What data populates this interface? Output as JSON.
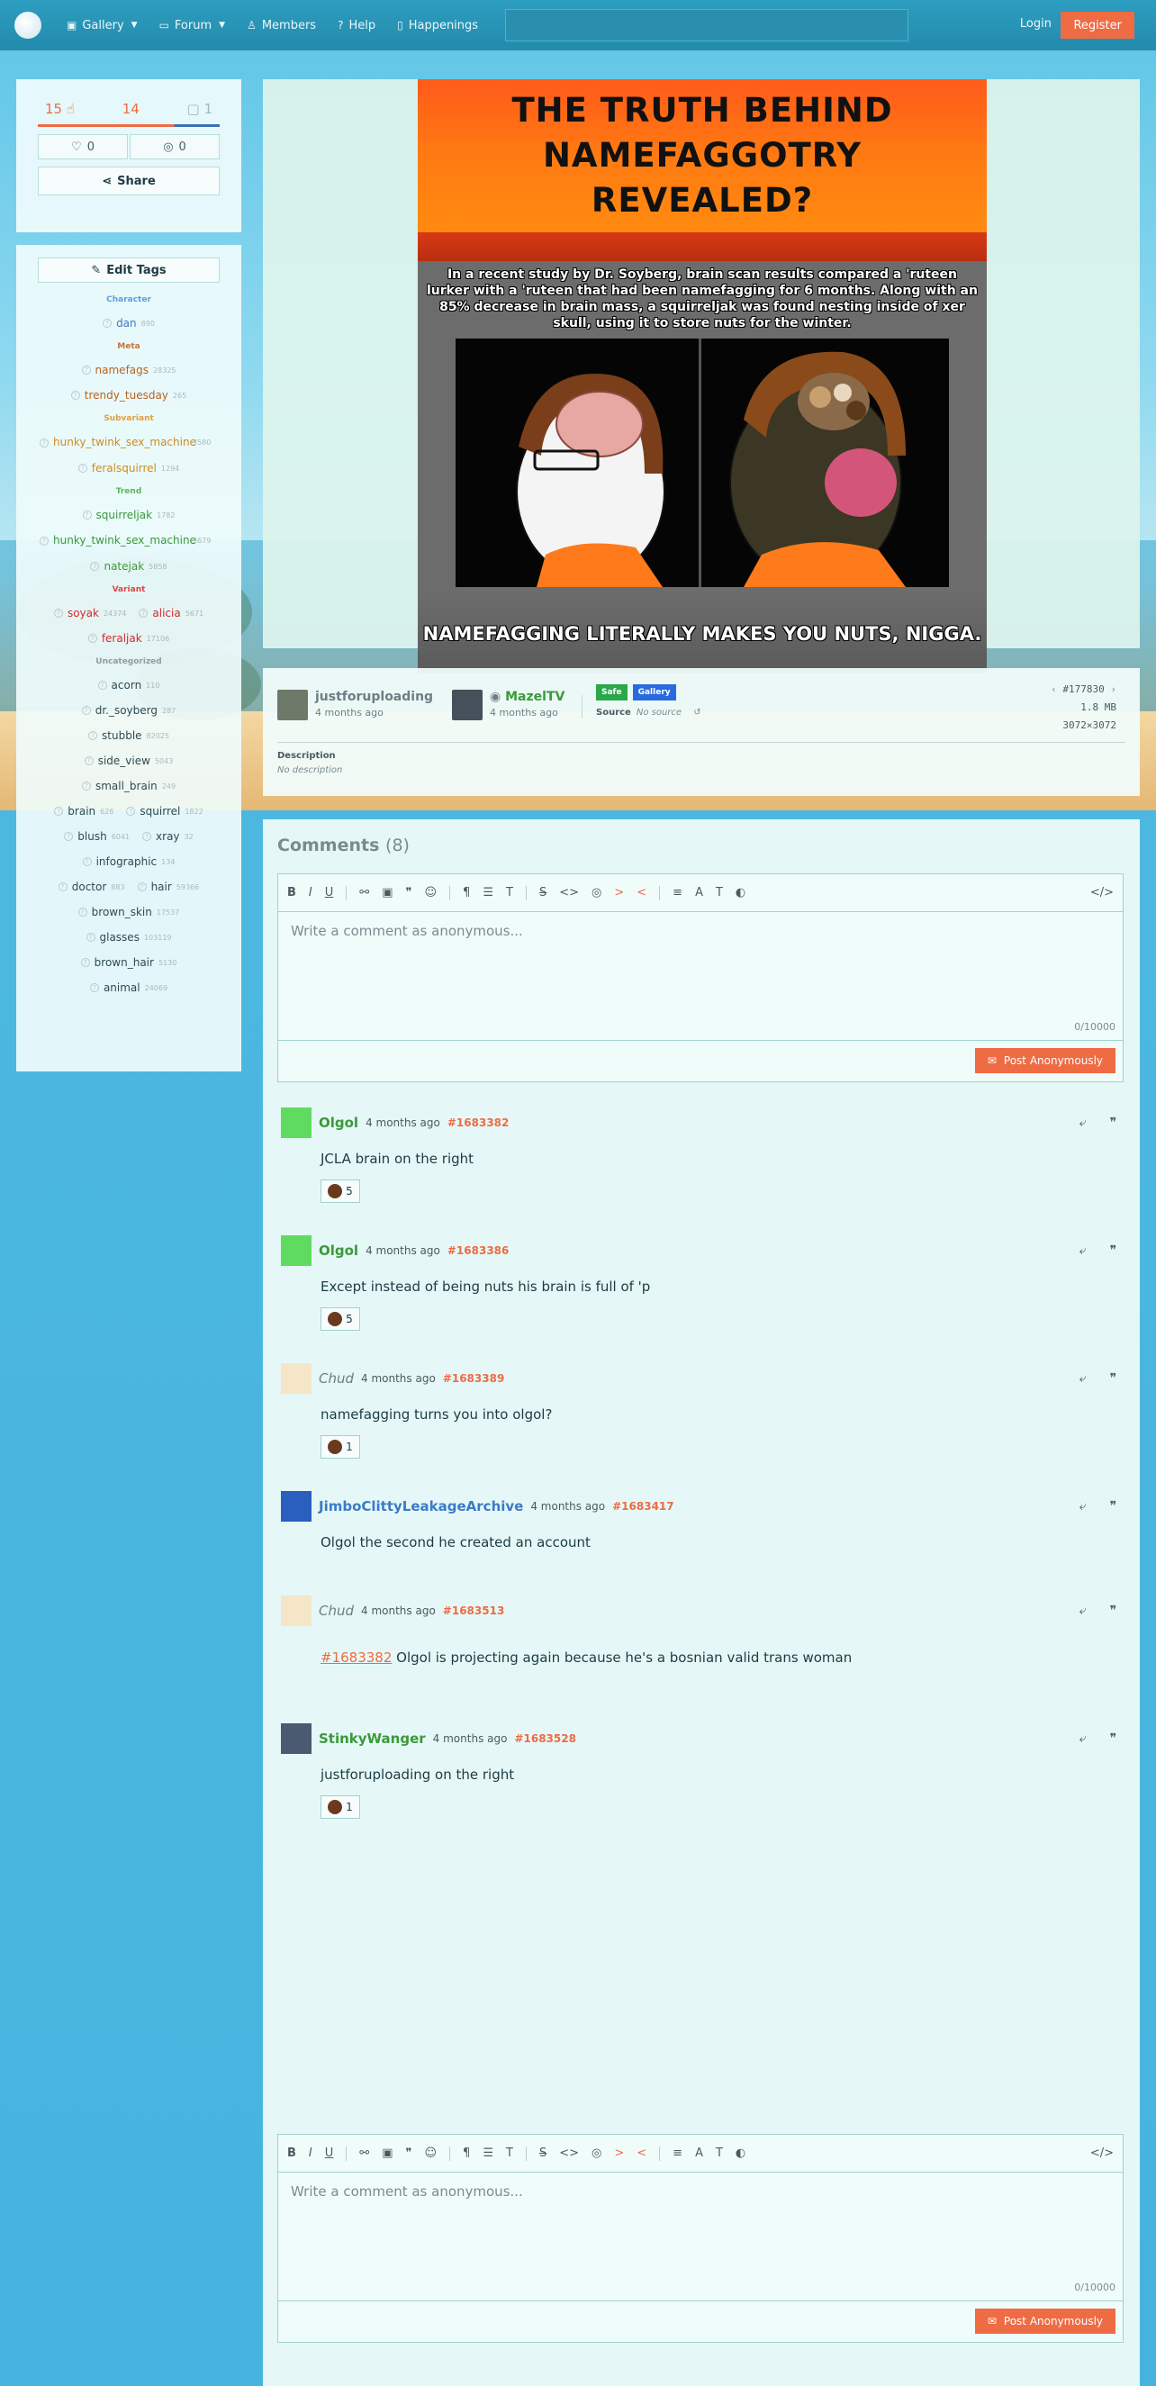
{
  "nav": {
    "items": [
      {
        "label": "Gallery",
        "icon": "image-icon",
        "has_dropdown": true
      },
      {
        "label": "Forum",
        "icon": "chat-icon",
        "has_dropdown": true
      },
      {
        "label": "Members",
        "icon": "user-icon",
        "has_dropdown": false
      },
      {
        "label": "Help",
        "icon": "help-icon",
        "has_dropdown": false
      },
      {
        "label": "Happenings",
        "icon": "book-icon",
        "has_dropdown": false
      }
    ],
    "search_placeholder": "",
    "login_label": "Login",
    "register_label": "Register"
  },
  "votes": {
    "upvotes": "15",
    "downvotes": "14",
    "comments": "1",
    "favorites": "0",
    "hidden": "0",
    "share_label": "Share"
  },
  "tags": {
    "edit_label": "Edit Tags",
    "categories": [
      {
        "name": "Character",
        "color": "#5aa0e0",
        "tags": [
          {
            "name": "dan",
            "count": "890",
            "color": "#3b7ac8"
          }
        ]
      },
      {
        "name": "Meta",
        "color": "#c4763a",
        "tags": [
          {
            "name": "namefags",
            "count": "28325",
            "color": "#b8621e"
          },
          {
            "name": "trendy_tuesday",
            "count": "265",
            "color": "#b8621e"
          }
        ]
      },
      {
        "name": "Subvariant",
        "color": "#e0a040",
        "tags": [
          {
            "name": "hunky_twink_sex_machine",
            "count": "3580",
            "color": "#d08a20"
          },
          {
            "name": "feralsquirrel",
            "count": "1294",
            "color": "#d08a20"
          }
        ]
      },
      {
        "name": "Trend",
        "color": "#5ab85a",
        "tags": [
          {
            "name": "squirreljak",
            "count": "1782",
            "color": "#3a9a3a"
          },
          {
            "name": "hunky_twink_sex_machine",
            "count": "3679",
            "color": "#3a9a3a"
          },
          {
            "name": "natejak",
            "count": "5858",
            "color": "#3a9a3a"
          }
        ]
      },
      {
        "name": "Variant",
        "color": "#e04545",
        "tags": [
          {
            "name": "soyak",
            "count": "24374",
            "color": "#d22b2b"
          },
          {
            "name": "alicia",
            "count": "5671",
            "color": "#d22b2b"
          },
          {
            "name": "feraljak",
            "count": "17106",
            "color": "#d22b2b"
          }
        ]
      },
      {
        "name": "Uncategorized",
        "color": "#8aa0a5",
        "tags": [
          {
            "name": "acorn",
            "count": "110"
          },
          {
            "name": "dr._soyberg",
            "count": "287"
          },
          {
            "name": "stubble",
            "count": "82025"
          },
          {
            "name": "side_view",
            "count": "5043"
          },
          {
            "name": "small_brain",
            "count": "249"
          },
          {
            "name": "brain",
            "count": "626"
          },
          {
            "name": "squirrel",
            "count": "1822"
          },
          {
            "name": "blush",
            "count": "6041"
          },
          {
            "name": "xray",
            "count": "32"
          },
          {
            "name": "infographic",
            "count": "134"
          },
          {
            "name": "doctor",
            "count": "883"
          },
          {
            "name": "hair",
            "count": "59366"
          },
          {
            "name": "brown_skin",
            "count": "17537"
          },
          {
            "name": "glasses",
            "count": "103119"
          },
          {
            "name": "brown_hair",
            "count": "5130"
          },
          {
            "name": "animal",
            "count": "24069"
          }
        ]
      }
    ]
  },
  "meme": {
    "title": "THE TRUTH BEHIND NAMEFAGGOTRY REVEALED?",
    "body": "In a recent study by Dr. Soyberg, brain scan results compared a 'ruteen lurker with a 'ruteen that had been namefagging for 6 months. Along with an 85% decrease in brain mass, a squirreljak was found nesting inside of xer skull, using it to store nuts for the winter.",
    "caption": "NAMEFAGGING LITERALLY MAKES YOU NUTS, NIGGA."
  },
  "post": {
    "uploader": "justforuploading",
    "uploader_time": "4 months ago",
    "approver": "MazelTV",
    "approver_time": "4 months ago",
    "rating_badge": "Safe",
    "type_badge": "Gallery",
    "source_label": "Source",
    "source_value": "No source",
    "post_id": "#177830",
    "filesize": "1.8 MB",
    "dimensions": "3072×3072",
    "description_label": "Description",
    "description_value": "No description"
  },
  "comments": {
    "header": "Comments",
    "count": "(8)",
    "placeholder": "Write a comment as anonymous...",
    "counter": "0/10000",
    "post_label": "Post Anonymously",
    "list": [
      {
        "user": "Olgol",
        "name_color": "#3a9a3a",
        "time": "4 months ago",
        "id": "#1683382",
        "text": "JCLA brain on the right",
        "reaction_count": "5"
      },
      {
        "user": "Olgol",
        "name_color": "#3a9a3a",
        "time": "4 months ago",
        "id": "#1683386",
        "text": "Except instead of being nuts his brain is full of 'p",
        "reaction_count": "5"
      },
      {
        "user": "Chud",
        "name_color": "#6c7f84",
        "time": "4 months ago",
        "id": "#1683389",
        "text": "namefagging turns you into olgol?",
        "reaction_count": "1"
      },
      {
        "user": "JimboClittyLeakageArchive",
        "name_color": "#3b7ac8",
        "time": "4 months ago",
        "id": "#1683417",
        "text": "Olgol the second he created an account",
        "reaction_count": ""
      },
      {
        "user": "Chud",
        "name_color": "#6c7f84",
        "time": "4 months ago",
        "id": "#1683513",
        "reply_ref": "#1683382",
        "text": " Olgol is projecting again because he's a bosnian valid trans woman",
        "reaction_count": ""
      },
      {
        "user": "StinkyWanger",
        "name_color": "#3a9a3a",
        "time": "4 months ago",
        "id": "#1683528",
        "text": "justforuploading on the right",
        "reaction_count": "1"
      }
    ]
  }
}
